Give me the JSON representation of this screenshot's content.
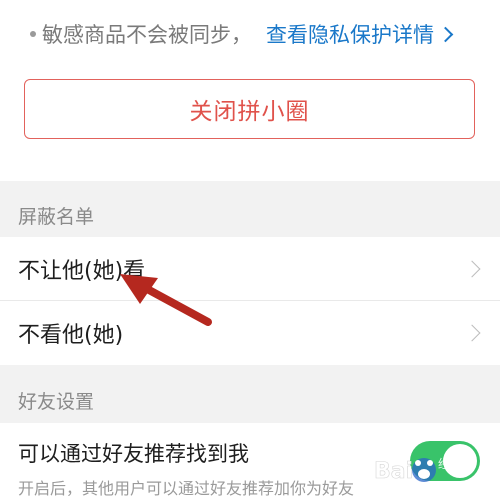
{
  "privacy": {
    "note": "敏感商品不会被同步，",
    "link": "查看隐私保护详情"
  },
  "close_circle_button": "关闭拼小圈",
  "block_list": {
    "header": "屏蔽名单",
    "items": [
      {
        "label": "不让他(她)看"
      },
      {
        "label": "不看他(她)"
      }
    ]
  },
  "friend_settings": {
    "header": "好友设置",
    "recommend": {
      "title": "可以通过好友推荐找到我",
      "description": "开启后，其他用户可以通过好友推荐加你为好友",
      "enabled": true
    }
  },
  "watermark": {
    "text": "Baidu经验"
  },
  "colors": {
    "accent_link": "#1a78c9",
    "danger": "#e0524b",
    "toggle_on": "#39c36a",
    "annotation_arrow": "#b5281f"
  }
}
